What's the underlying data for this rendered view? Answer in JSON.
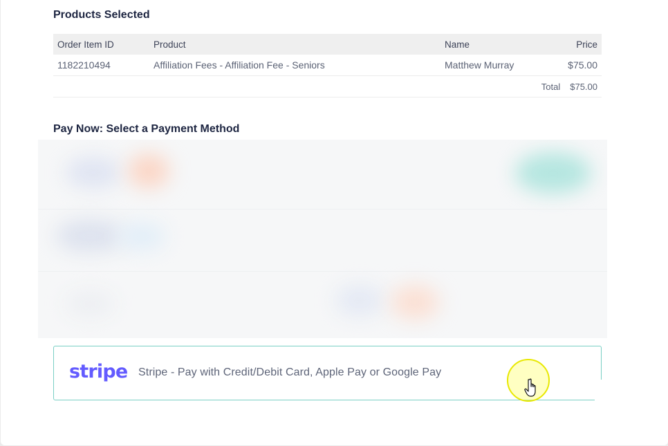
{
  "products": {
    "title": "Products Selected",
    "columns": [
      "Order Item ID",
      "Product",
      "Name",
      "Price"
    ],
    "rows": [
      {
        "order_item_id": "1182210494",
        "product": "Affiliation Fees - Affiliation Fee - Seniors",
        "name": "Matthew Murray",
        "price": "$75.00"
      }
    ],
    "total_label": "Total",
    "total_value": "$75.00"
  },
  "payment": {
    "title": "Pay Now: Select a Payment Method",
    "stripe": {
      "logo_text": "stripe",
      "description": "Stripe - Pay with Credit/Debit Card, Apple Pay or Google Pay",
      "brand_color": "#635bff",
      "border_color": "#78cfc4"
    }
  },
  "icons": {
    "cursor": "hand-pointer-icon"
  }
}
